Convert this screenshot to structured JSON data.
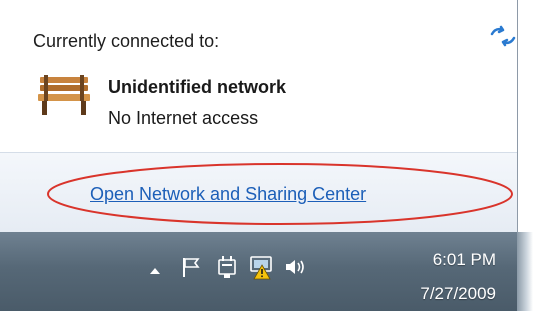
{
  "flyout": {
    "heading": "Currently connected to:",
    "network": {
      "name": "Unidentified network",
      "status": "No Internet access",
      "icon": "bench-icon"
    },
    "refresh_icon": "network-refresh-icon",
    "link_text": "Open Network and Sharing Center",
    "link_color": "#1c5fb8",
    "highlight_color": "#d9342b"
  },
  "taskbar": {
    "tray_icons": [
      "show-hidden-icons-arrow-icon",
      "action-center-flag-icon",
      "power-plug-icon",
      "network-warning-icon",
      "volume-speaker-icon"
    ],
    "clock": {
      "time": "6:01 PM",
      "date": "7/27/2009"
    }
  }
}
